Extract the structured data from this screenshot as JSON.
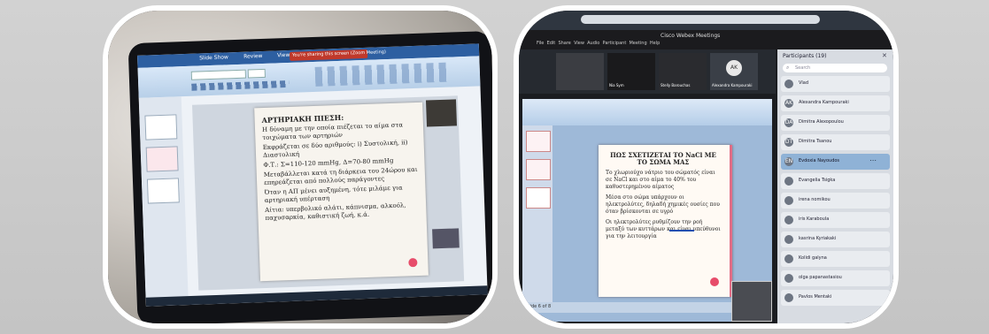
{
  "left_photo": {
    "ribbon_tabs": [
      "Slide Show",
      "Review",
      "View"
    ],
    "warning_bar": "You're sharing this screen (Zoom Meeting)",
    "slide": {
      "title": "ΑΡΤΗΡΙΑΚΗ ΠΙΕΣΗ:",
      "bullets": [
        "Η δύναμη με την οποία πιέζεται το αίμα στα τοιχώματα των αρτηριών",
        "Εκφράζεται σε δύο αριθμούς: i) Συστολική, ii) Διαστολική",
        "Φ.Τ.: Σ=110-120 mmHg, Δ=70-80 mmHg",
        "Μεταβάλλεται κατά τη διάρκεια του 24ώρου και επηρεάζεται από πολλούς παράγοντες",
        "Όταν η ΑΠ μένει αυξημένη, τότε μιλάμε για αρτηριακή υπέρταση",
        "Αίτια: υπερβολικό αλάτι, κάπνισμα, αλκοόλ, παχυσαρκία, καθιστική ζωή, κ.ά."
      ]
    }
  },
  "right_photo": {
    "window_title": "Cisco Webex Meetings",
    "menu": [
      "File",
      "Edit",
      "Share",
      "View",
      "Audio",
      "Participant",
      "Meeting",
      "Help"
    ],
    "video_tiles": [
      {
        "name": "",
        "initials": ""
      },
      {
        "name": "Nia Sym",
        "initials": ""
      },
      {
        "name": "Stelly Barouchas",
        "initials": ""
      },
      {
        "name": "Alexandra Kampouraki",
        "initials": "AK"
      }
    ],
    "participants_header": "Participants (19)",
    "search_placeholder": "Search",
    "participants": [
      {
        "initials": "",
        "name": "Vlad"
      },
      {
        "initials": "AK",
        "name": "Alexandra Kampouraki"
      },
      {
        "initials": "DA",
        "name": "Dimitra Alexopoulou"
      },
      {
        "initials": "DT",
        "name": "Dimitra Tsanou"
      },
      {
        "initials": "EN",
        "name": "Evdoxia Nayoudos"
      },
      {
        "initials": "",
        "name": "Evangelia Tsigka"
      },
      {
        "initials": "",
        "name": "irena nomikou"
      },
      {
        "initials": "",
        "name": "iris Karaboula"
      },
      {
        "initials": "",
        "name": "kasrina Kyriakaki"
      },
      {
        "initials": "",
        "name": "Kolidi galyna"
      },
      {
        "initials": "",
        "name": "olga papanastasiou"
      },
      {
        "initials": "",
        "name": "Pavlos Mentaki"
      }
    ],
    "slide": {
      "title": "ΠΩΣ ΣΧΕΤΙΖΕΤΑΙ ΤΟ NaCl ΜΕ ΤΟ ΣΩΜΑ ΜΑΣ",
      "bullets": [
        "Το χλωριούχο νάτριο του σώματός είναι σε ΝaCl και στο αίμα το 40% του καθυστερημένου αίματος",
        "Μέσα στο σώμα υπάρχουν οι ηλεκτρολύτες, δηλαδή χημικές ουσίες που όταν βρίσκονται σε υγρό",
        "Οι ηλεκτρολύτες ρυθμίζουν την ροή μεταξύ των κυττάρων και είναι υπεύθυνοι για την λειτουργία"
      ]
    },
    "status_bar": "Slide 6 of 8"
  }
}
